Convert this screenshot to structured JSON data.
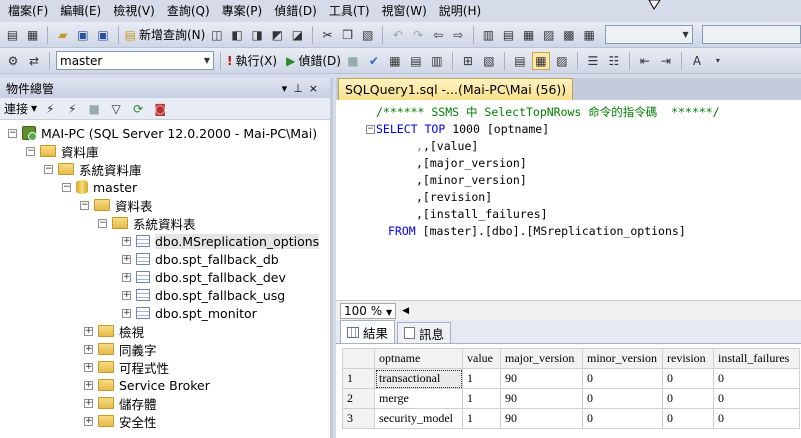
{
  "menu": [
    "檔案(F)",
    "編輯(E)",
    "檢視(V)",
    "查詢(Q)",
    "專案(P)",
    "偵錯(D)",
    "工具(T)",
    "視窗(W)",
    "說明(H)"
  ],
  "toolbar1": {
    "new_query_label": "新增查詢(N)"
  },
  "toolbar2": {
    "database": "master",
    "execute_label": "執行(X)",
    "debug_label": "偵錯(D)"
  },
  "object_explorer": {
    "title": "物件總管",
    "connect_label": "連接",
    "nodes": [
      "MAI-PC (SQL Server 12.0.2000 - Mai-PC\\Mai)",
      "資料庫",
      "系統資料庫",
      "master",
      "資料表",
      "系統資料表",
      "dbo.MSreplication_options",
      "dbo.spt_fallback_db",
      "dbo.spt_fallback_dev",
      "dbo.spt_fallback_usg",
      "dbo.spt_monitor",
      "檢視",
      "同義字",
      "可程式性",
      "Service Broker",
      "儲存體",
      "安全性"
    ]
  },
  "editor": {
    "tab_title": "SQLQuery1.sql -...(Mai-PC\\Mai (56))",
    "comment": "/****** SSMS 中 SelectTopNRows 命令的指令碼  ******/",
    "select_kw": "SELECT",
    "top_kw": "TOP",
    "top_n": "1000",
    "columns": [
      "[optname]",
      ",[value]",
      ",[major_version]",
      ",[minor_version]",
      ",[revision]",
      ",[install_failures]"
    ],
    "from_kw": "FROM",
    "from_target": "[master].[dbo].[MSreplication_options]",
    "zoom": "100 %"
  },
  "results": {
    "tab_results": "結果",
    "tab_messages": "訊息",
    "columns": [
      "optname",
      "value",
      "major_version",
      "minor_version",
      "revision",
      "install_failures"
    ],
    "rows": [
      [
        "1",
        "transactional",
        "1",
        "90",
        "0",
        "0",
        "0"
      ],
      [
        "2",
        "merge",
        "1",
        "90",
        "0",
        "0",
        "0"
      ],
      [
        "3",
        "security_model",
        "1",
        "90",
        "0",
        "0",
        "0"
      ]
    ]
  }
}
